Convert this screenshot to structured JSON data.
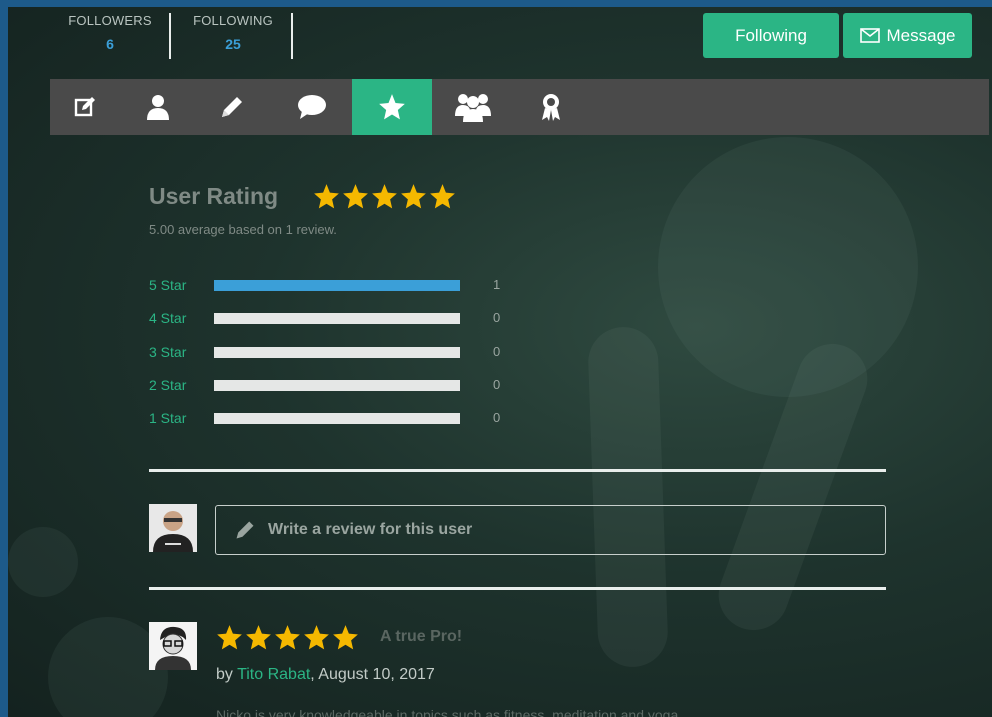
{
  "stats": {
    "followers": {
      "label": "FOLLOWERS",
      "value": "6"
    },
    "following": {
      "label": "FOLLOWING",
      "value": "25"
    }
  },
  "actions": {
    "following_label": "Following",
    "message_label": "Message"
  },
  "tabs": [
    {
      "icon": "edit-icon",
      "active": false
    },
    {
      "icon": "user-icon",
      "active": false
    },
    {
      "icon": "pencil-icon",
      "active": false
    },
    {
      "icon": "chat-bubble-icon",
      "active": false
    },
    {
      "icon": "star-icon",
      "active": true
    },
    {
      "icon": "group-icon",
      "active": false
    },
    {
      "icon": "award-icon",
      "active": false
    }
  ],
  "rating": {
    "title": "User Rating",
    "stars": 5,
    "summary": "5.00 average based on 1 review.",
    "breakdown": [
      {
        "label": "5 Star",
        "count": "1",
        "fraction": 1
      },
      {
        "label": "4 Star",
        "count": "0",
        "fraction": 0
      },
      {
        "label": "3 Star",
        "count": "0",
        "fraction": 0
      },
      {
        "label": "2 Star",
        "count": "0",
        "fraction": 0
      },
      {
        "label": "1 Star",
        "count": "0",
        "fraction": 0
      }
    ]
  },
  "write_review": {
    "placeholder": "Write a review for this user"
  },
  "review": {
    "stars": 5,
    "title": "A true Pro!",
    "by": "by",
    "author": "Tito Rabat",
    "date": ", August 10, 2017",
    "text": "Nicko is very knowledgeable in topics such as fitness, meditation and yoga."
  },
  "colors": {
    "accent": "#2bb585",
    "bar_fill": "#3b9fd8",
    "star": "#f5b800",
    "tab_bar": "#4a4a4a"
  }
}
